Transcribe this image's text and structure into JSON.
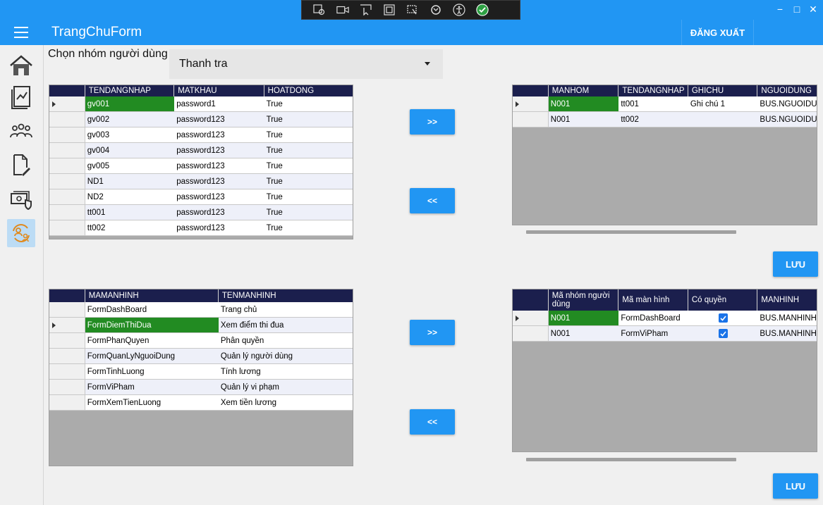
{
  "window": {
    "title": "TrangChuForm",
    "logout_label": "ĐĂNG XUẤT",
    "minimize": "−",
    "maximize": "□",
    "close": "✕"
  },
  "colors": {
    "accent": "#2196f3",
    "grid_header": "#1b1f4d",
    "selected_cell": "#228b22",
    "grid_empty": "#ababab"
  },
  "sidebar": {
    "items": [
      {
        "icon": "home-icon"
      },
      {
        "icon": "chart-report-icon"
      },
      {
        "icon": "users-group-icon"
      },
      {
        "icon": "document-edit-icon"
      },
      {
        "icon": "money-shield-icon"
      },
      {
        "icon": "user-switch-icon"
      }
    ]
  },
  "group_selector": {
    "label": "Chọn nhóm người dùng",
    "value": "Thanh tra"
  },
  "users_grid": {
    "columns": [
      "TENDANGNHAP",
      "MATKHAU",
      "HOATDONG"
    ],
    "rows": [
      [
        "gv001",
        "password1",
        "True"
      ],
      [
        "gv002",
        "password123",
        "True"
      ],
      [
        "gv003",
        "password123",
        "True"
      ],
      [
        "gv004",
        "password123",
        "True"
      ],
      [
        "gv005",
        "password123",
        "True"
      ],
      [
        "ND1",
        "password123",
        "True"
      ],
      [
        "ND2",
        "password123",
        "True"
      ],
      [
        "tt001",
        "password123",
        "True"
      ],
      [
        "tt002",
        "password123",
        "True"
      ]
    ]
  },
  "group_users_grid": {
    "columns": [
      "MANHOM",
      "TENDANGNHAP",
      "GHICHU",
      "NGUOIDUNG"
    ],
    "rows": [
      [
        "N001",
        "tt001",
        "Ghi chú 1",
        "BUS.NGUOIDUI"
      ],
      [
        "N001",
        "tt002",
        "",
        "BUS.NGUOIDUI"
      ]
    ]
  },
  "screens_grid": {
    "columns": [
      "MAMANHINH",
      "TENMANHINH"
    ],
    "rows": [
      [
        "FormDashBoard",
        "Trang chủ"
      ],
      [
        "FormDiemThiDua",
        "Xem điểm thi đua"
      ],
      [
        "FormPhanQuyen",
        "Phân quyền"
      ],
      [
        "FormQuanLyNguoiDung",
        "Quản lý người dùng"
      ],
      [
        "FormTinhLuong",
        "Tính lương"
      ],
      [
        "FormViPham",
        "Quản lý vi phạm"
      ],
      [
        "FormXemTienLuong",
        "Xem tiền lương"
      ]
    ]
  },
  "permissions_grid": {
    "columns": [
      "Mã nhóm người dùng",
      "Mã màn hình",
      "Có quyền",
      "MANHINH"
    ],
    "rows": [
      {
        "group": "N001",
        "screen": "FormDashBoard",
        "granted": true,
        "obj": "BUS.MANHINH"
      },
      {
        "group": "N001",
        "screen": "FormViPham",
        "granted": true,
        "obj": "BUS.MANHINH"
      }
    ]
  },
  "buttons": {
    "add": ">>",
    "remove": "<<",
    "save": "LƯU"
  }
}
